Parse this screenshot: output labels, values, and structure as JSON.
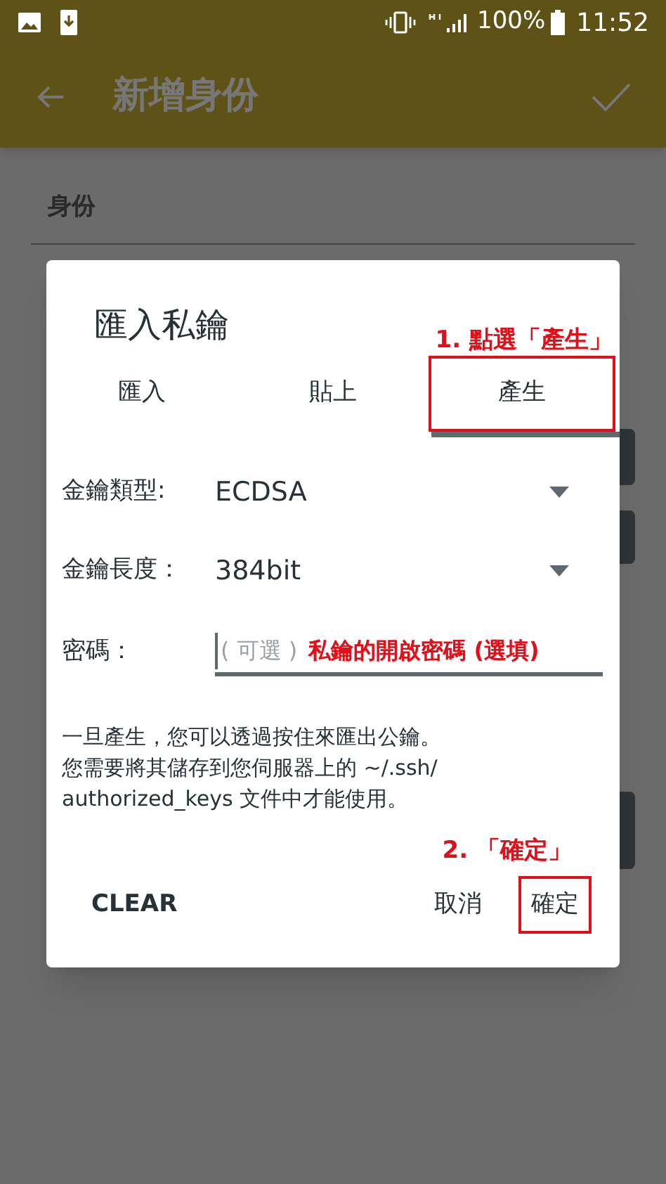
{
  "status_bar": {
    "battery": "100%",
    "time": "11:52"
  },
  "app_bar": {
    "title": "新增身份"
  },
  "background": {
    "section": "身份"
  },
  "dialog": {
    "title": "匯入私鑰",
    "tabs": [
      {
        "label": "匯入",
        "selected": false
      },
      {
        "label": "貼上",
        "selected": false
      },
      {
        "label": "產生",
        "selected": true
      }
    ],
    "fields": [
      {
        "kind": "dropdown",
        "label": "金鑰類型:",
        "value": "ECDSA"
      },
      {
        "kind": "dropdown",
        "label": "金鑰長度：",
        "value": "384bit"
      },
      {
        "kind": "input",
        "label": "密碼：",
        "placeholder": "( 可選 )",
        "note": "私鑰的開啟密碼 (選填)"
      }
    ],
    "description": [
      "一旦產生，您可以透過按住來匯出公鑰。",
      "您需要將其儲存到您伺服器上的 ~/.ssh/",
      "authorized_keys 文件中才能使用。"
    ],
    "step_notes": [
      "1. 點選「產生」",
      "2. 「確定」"
    ],
    "buttons": {
      "left": "CLEAR",
      "cancel": "取消",
      "ok": "確定"
    }
  }
}
